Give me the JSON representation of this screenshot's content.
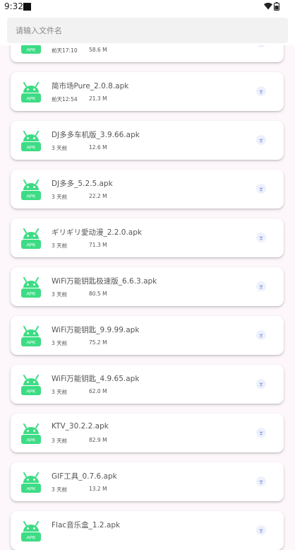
{
  "status_bar": {
    "time": "9:32"
  },
  "search": {
    "placeholder": "请输入文件名",
    "value": ""
  },
  "icon_label": "APK",
  "files": [
    {
      "name": "",
      "date": "前天17:10",
      "size": "58.6 M"
    },
    {
      "name": "简市场Pure_2.0.8.apk",
      "date": "前天12:54",
      "size": "21.3 M"
    },
    {
      "name": "DJ多多车机版_3.9.66.apk",
      "date": "3 天前",
      "size": "12.6 M"
    },
    {
      "name": "DJ多多_5.2.5.apk",
      "date": "3 天前",
      "size": "22.2 M"
    },
    {
      "name": "ギリギリ愛动漫_2.2.0.apk",
      "date": "3 天前",
      "size": "71.3 M"
    },
    {
      "name": "WiFi万能钥匙极速版_6.6.3.apk",
      "date": "3 天前",
      "size": "80.5 M"
    },
    {
      "name": "WiFi万能钥匙_9.9.99.apk",
      "date": "3 天前",
      "size": "75.2 M"
    },
    {
      "name": "WiFi万能钥匙_4.9.65.apk",
      "date": "3 天前",
      "size": "62.0 M"
    },
    {
      "name": "KTV_30.2.2.apk",
      "date": "3 天前",
      "size": "82.9 M"
    },
    {
      "name": "GIF工具_0.7.6.apk",
      "date": "3 天前",
      "size": "13.2 M"
    },
    {
      "name": "Flac音乐盒_1.2.apk",
      "date": "",
      "size": ""
    }
  ],
  "colors": {
    "accent_green": "#3ddc84",
    "page_background": "#fdf7fb",
    "card_background": "#ffffff"
  }
}
